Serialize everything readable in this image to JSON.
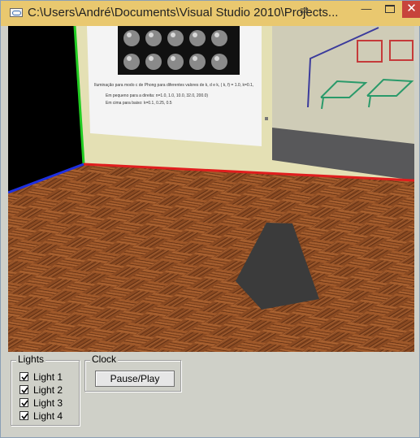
{
  "window": {
    "title": "C:\\Users\\André\\Documents\\Visual Studio 2010\\Projects...",
    "minimize_glyph": "—",
    "close_glyph": "✕"
  },
  "scene": {
    "poster_caption_line1": "Iluminação para modo c de Phong para diferentes valores de k, d e k, ( k, f) = 1.0, k=0.1,",
    "poster_caption_line2": "Em pequeno para a direita: n=1.0, 1.0, 10.0, 32.0, 200.0)",
    "poster_caption_line3": "Em cima para baixo: k=0.1, 0.25, 0.5"
  },
  "controls": {
    "lights_group_label": "Lights",
    "lights": [
      {
        "label": "Light 1",
        "checked": true
      },
      {
        "label": "Light 2",
        "checked": true
      },
      {
        "label": "Light 3",
        "checked": true
      },
      {
        "label": "Light 4",
        "checked": true
      }
    ],
    "clock_group_label": "Clock",
    "pause_button_label": "Pause/Play"
  }
}
